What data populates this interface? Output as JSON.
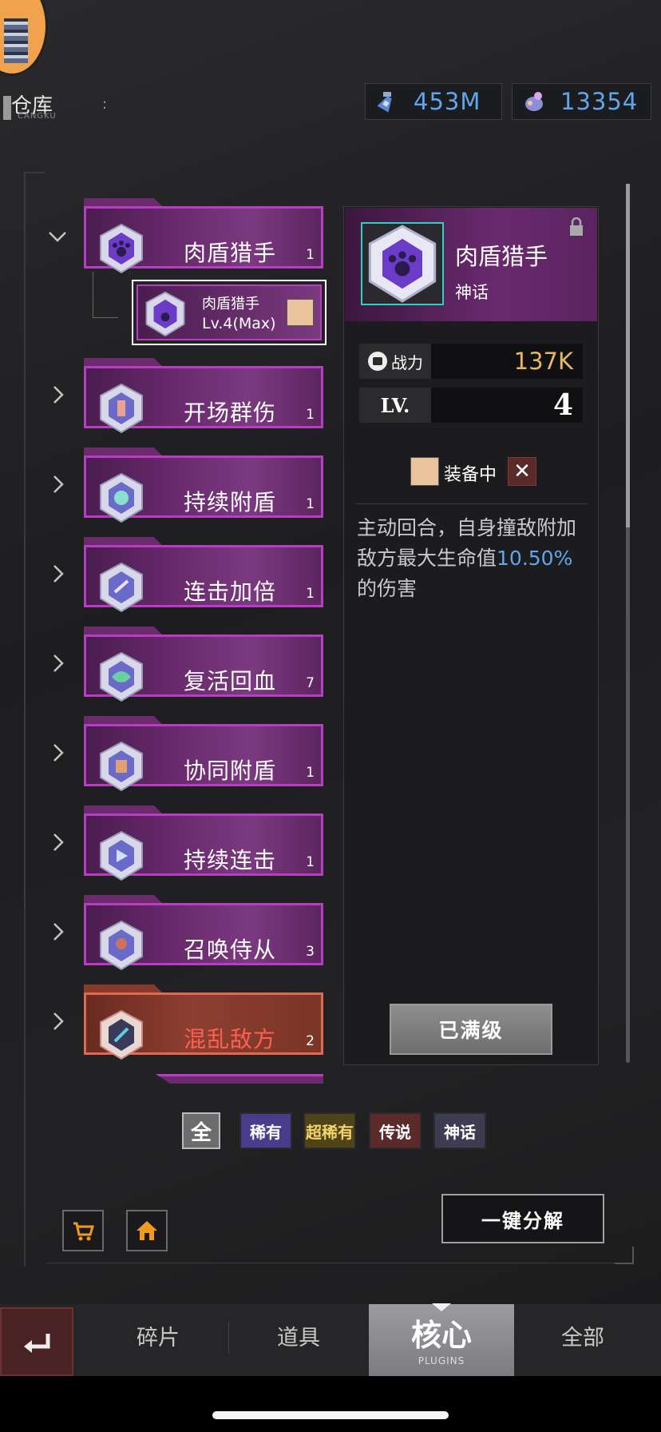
{
  "header": {
    "depot_label": "仓库",
    "depot_sub": "CANGKU",
    "currency": [
      {
        "icon": "potion-icon",
        "value": "453M"
      },
      {
        "icon": "pig-bank-icon",
        "value": "13354"
      }
    ]
  },
  "list": {
    "expanded": {
      "name": "肉盾猎手",
      "count": "1",
      "sub": {
        "name": "肉盾猎手",
        "level": "Lv.4(Max)"
      }
    },
    "items": [
      {
        "name": "开场群伤",
        "count": "1"
      },
      {
        "name": "持续附盾",
        "count": "1"
      },
      {
        "name": "连击加倍",
        "count": "1"
      },
      {
        "name": "复活回血",
        "count": "7"
      },
      {
        "name": "协同附盾",
        "count": "1"
      },
      {
        "name": "持续连击",
        "count": "1"
      },
      {
        "name": "召唤侍从",
        "count": "3"
      },
      {
        "name": "混乱敌方",
        "count": "2"
      }
    ]
  },
  "detail": {
    "name": "肉盾猎手",
    "rarity": "神话",
    "power_label": "战力",
    "power_value": "137K",
    "lv_label": "LV.",
    "lv_value": "4",
    "equip_label": "装备中",
    "unequip_glyph": "✕",
    "desc_pre": "主动回合，自身撞敌附加敌方最大生命值",
    "desc_hl": "10.50%",
    "desc_post": "的伤害",
    "maxed_label": "已满级"
  },
  "filters": [
    "全",
    "稀有",
    "超稀有",
    "传说",
    "神话"
  ],
  "actions": {
    "dismantle_label": "一键分解"
  },
  "nav": {
    "tabs": [
      "碎片",
      "道具",
      "全部"
    ],
    "active": "核心",
    "active_sub": "PLUGINS"
  },
  "colors": {
    "accent_blue": "#5fa7ea",
    "power_gold": "#e8b762",
    "myth_border": "#b93cc4",
    "legend_name": "#ff5e52"
  }
}
